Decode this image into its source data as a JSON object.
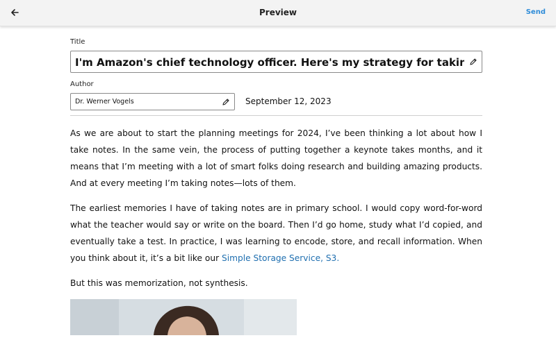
{
  "header": {
    "title": "Preview",
    "send_label": "Send",
    "back_icon": "arrow-left-icon"
  },
  "form": {
    "title_label": "Title",
    "title_value": "I'm Amazon's chief technology officer. Here's my strategy for taking effect…",
    "author_label": "Author",
    "author_value": "Dr. Werner Vogels",
    "date": "September 12, 2023",
    "edit_icon": "pencil-icon"
  },
  "article": {
    "para1": "As we are about to start the planning meetings for 2024, I’ve been thinking a lot about how I take notes. In the same vein, the process of putting together a keynote takes months, and it means that I’m meeting with a lot of smart folks doing research and building amazing products. And at every meeting I’m taking notes—lots of them.",
    "para2_text": "The earliest memories I have of taking notes are in primary school. I would copy word-for-word what the teacher would say or write on the board. Then I’d go home, study what I’d copied, and eventually take a test. In practice, I was learning to encode, store, and recall information. When you think about it, it’s a bit like our ",
    "para2_link": "Simple Storage Service, S3.",
    "para3": "But this was memorization, not synthesis."
  },
  "colors": {
    "accent": "#2f8cd8",
    "link": "#1f6fb0"
  }
}
